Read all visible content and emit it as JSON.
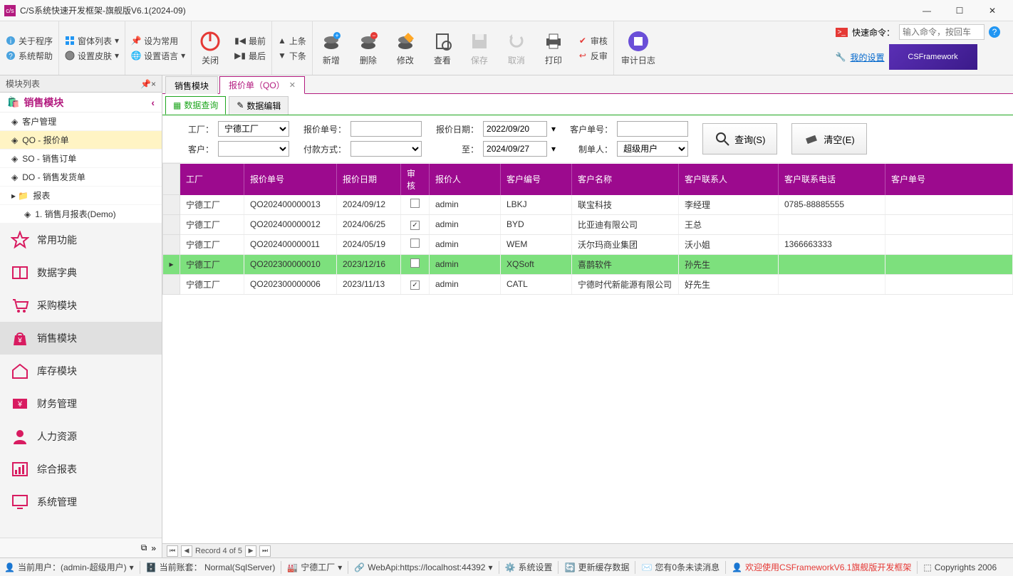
{
  "window": {
    "title": "C/S系统快速开发框架-旗舰版V6.1(2024-09)"
  },
  "menu": {
    "about": "关于程序",
    "winlist": "窗体列表",
    "sethome": "设为常用",
    "syshelp": "系统帮助",
    "skin": "设置皮肤",
    "lang": "设置语言",
    "close": "关闭",
    "first": "最前",
    "prev": "上条",
    "last": "最后",
    "next": "下条",
    "add": "新增",
    "del": "删除",
    "edit": "修改",
    "view": "查看",
    "save": "保存",
    "cancel": "取消",
    "print": "打印",
    "approve": "审核",
    "reject": "反审",
    "audit": "审计日志",
    "quicklabel": "快速命令：",
    "quickplaceholder": "输入命令，按回车",
    "mysettings": "我的设置",
    "banner": "CSFramework"
  },
  "sidebar": {
    "title": "模块列表",
    "group": "销售模块",
    "tree": {
      "cust": "客户管理",
      "qo": "QO - 报价单",
      "so": "SO - 销售订单",
      "do": "DO - 销售发货单",
      "report": "报表",
      "rpt1": "1. 销售月报表(Demo)"
    },
    "mods": {
      "fav": "常用功能",
      "dict": "数据字典",
      "purchase": "采购模块",
      "sales": "销售模块",
      "stock": "库存模块",
      "finance": "财务管理",
      "hr": "人力资源",
      "reports": "综合报表",
      "sys": "系统管理"
    }
  },
  "tabs": {
    "t1": "销售模块",
    "t2": "报价单（QO）"
  },
  "innertabs": {
    "query": "数据查询",
    "edit": "数据编辑"
  },
  "search": {
    "factory_l": "工厂：",
    "factory_v": "宁德工厂",
    "customer_l": "客户：",
    "qo_l": "报价单号：",
    "pay_l": "付款方式：",
    "date_l": "报价日期：",
    "date_from": "2022/09/20",
    "date_to_l": "至：",
    "date_to": "2024/09/27",
    "custno_l": "客户单号：",
    "creator_l": "制单人：",
    "creator_v": "超级用户",
    "query_btn": "查询(S)",
    "clear_btn": "清空(E)"
  },
  "grid": {
    "cols": {
      "factory": "工厂",
      "qo": "报价单号",
      "date": "报价日期",
      "approve": "审核",
      "quoter": "报价人",
      "custcode": "客户编号",
      "custname": "客户名称",
      "contact": "客户联系人",
      "phone": "客户联系电话",
      "custno": "客户单号"
    },
    "rows": [
      {
        "factory": "宁德工厂",
        "qo": "QO202400000013",
        "date": "2024/09/12",
        "approved": false,
        "quoter": "admin",
        "custcode": "LBKJ",
        "custname": "联宝科技",
        "contact": "李经理",
        "phone": "0785-88885555",
        "custno": ""
      },
      {
        "factory": "宁德工厂",
        "qo": "QO202400000012",
        "date": "2024/06/25",
        "approved": true,
        "quoter": "admin",
        "custcode": "BYD",
        "custname": "比亚迪有限公司",
        "contact": "王总",
        "phone": "",
        "custno": ""
      },
      {
        "factory": "宁德工厂",
        "qo": "QO202400000011",
        "date": "2024/05/19",
        "approved": false,
        "quoter": "admin",
        "custcode": "WEM",
        "custname": "沃尔玛商业集团",
        "contact": "沃小姐",
        "phone": "1366663333",
        "custno": ""
      },
      {
        "factory": "宁德工厂",
        "qo": "QO202300000010",
        "date": "2023/12/16",
        "approved": false,
        "quoter": "admin",
        "custcode": "XQSoft",
        "custname": "喜鹊软件",
        "contact": "孙先生",
        "phone": "",
        "custno": "",
        "selected": true
      },
      {
        "factory": "宁德工厂",
        "qo": "QO202300000006",
        "date": "2023/11/13",
        "approved": true,
        "quoter": "admin",
        "custcode": "CATL",
        "custname": "宁德时代新能源有限公司",
        "contact": "好先生",
        "phone": "",
        "custno": ""
      }
    ],
    "footer": "Record 4 of 5"
  },
  "status": {
    "user": "当前用户：(admin-超级用户)",
    "account": "当前账套： Normal(SqlServer)",
    "factory": "宁德工厂",
    "webapi": "WebApi:https://localhost:44392",
    "syscfg": "系统设置",
    "refresh": "更新缓存数据",
    "msg": "您有0条未读消息",
    "welcome": "欢迎使用CSFrameworkV6.1旗舰版开发框架",
    "copy": "Copyrights 2006"
  }
}
